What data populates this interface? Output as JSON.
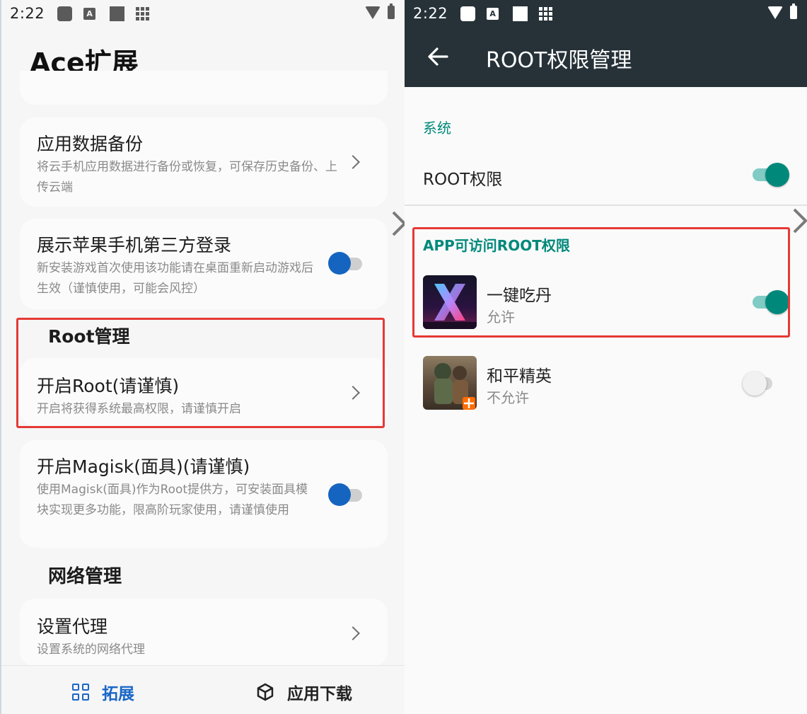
{
  "left_screen": {
    "status_bar": {
      "time": "2:22",
      "a_icon": "A"
    },
    "app_title": "Ace扩展",
    "cards": [
      {
        "title": "应用数据备份",
        "desc": "将云手机应用数据进行备份或恢复，可保存历史备份、上传云端"
      },
      {
        "title": "展示苹果手机第三方登录",
        "desc": "新安装游戏首次使用该功能请在桌面重新启动游戏后生效（谨慎使用，可能会风控）"
      },
      {
        "title": "开启Root(请谨慎)",
        "desc": "开启将获得系统最高权限，请谨慎开启"
      },
      {
        "title": "开启Magisk(面具)(请谨慎)",
        "desc": "使用Magisk(面具)作为Root提供方，可安装面具模块实现更多功能，限高阶玩家使用，请谨慎使用"
      },
      {
        "title": "设置代理",
        "desc": "设置系统的网络代理"
      }
    ],
    "sections": {
      "root": "Root管理",
      "network": "网络管理"
    },
    "bottom_nav": {
      "extend": "拓展",
      "download": "应用下载"
    }
  },
  "right_screen": {
    "status_bar": {
      "time": "2:22",
      "a_icon": "A"
    },
    "title": "ROOT权限管理",
    "section_system": "系统",
    "root_label": "ROOT权限",
    "section_apps": "APP可访问ROOT权限",
    "apps": [
      {
        "name": "一键吃丹",
        "status": "允许",
        "enabled": true
      },
      {
        "name": "和平精英",
        "status": "不允许",
        "enabled": false
      }
    ]
  },
  "colors": {
    "accent_blue": "#1565c0",
    "teal": "#00897b",
    "highlight_red": "#e53935",
    "toolbar_dark": "#263238"
  }
}
